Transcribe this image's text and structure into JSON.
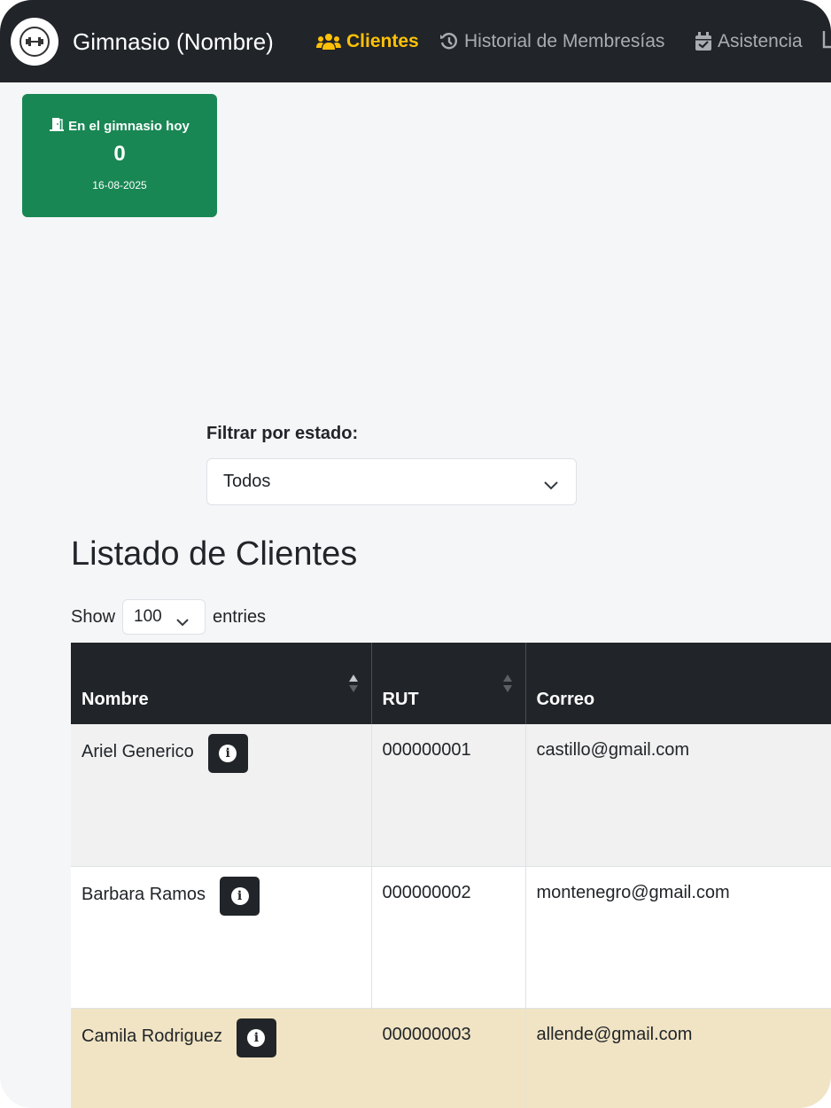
{
  "navbar": {
    "brand": "Gimnasio (Nombre)",
    "items": [
      {
        "label": "Clientes",
        "icon": "users-icon",
        "active": true
      },
      {
        "label": "Historial de Membresías",
        "icon": "history-icon",
        "active": false
      },
      {
        "label": "Asistencia",
        "icon": "calendar-check-icon",
        "active": false
      }
    ],
    "colors": {
      "background": "#212529",
      "active": "#ffc107",
      "inactive": "#a9adb2"
    }
  },
  "attendance_card": {
    "title": "En el gimnasio hoy",
    "count": "0",
    "date": "16-08-2025",
    "icon": "door-open-icon",
    "color": "#198754"
  },
  "filter": {
    "label": "Filtrar por estado:",
    "selected": "Todos"
  },
  "list": {
    "title": "Listado de Clientes",
    "show_label": "Show",
    "entries_value": "100",
    "entries_label": "entries"
  },
  "table": {
    "columns": [
      "Nombre",
      "RUT",
      "Correo"
    ],
    "rows": [
      {
        "nombre": "Ariel Generico",
        "rut": "000000001",
        "correo": "castillo@gmail.com"
      },
      {
        "nombre": "Barbara Ramos",
        "rut": "000000002",
        "correo": "montenegro@gmail.com"
      },
      {
        "nombre": "Camila Rodriguez",
        "rut": "000000003",
        "correo": "allende@gmail.com"
      }
    ]
  }
}
